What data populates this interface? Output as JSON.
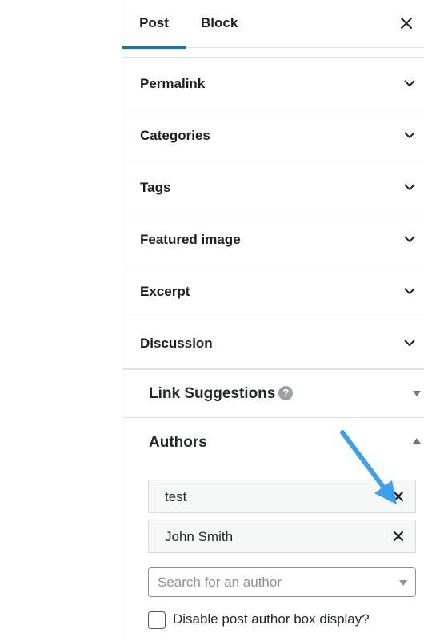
{
  "tabs": {
    "post": "Post",
    "block": "Block"
  },
  "panels": [
    {
      "label": "Permalink"
    },
    {
      "label": "Categories"
    },
    {
      "label": "Tags"
    },
    {
      "label": "Featured image"
    },
    {
      "label": "Excerpt"
    },
    {
      "label": "Discussion"
    }
  ],
  "link_suggestions": {
    "label": "Link Suggestions",
    "help_glyph": "?"
  },
  "authors": {
    "label": "Authors",
    "chips": [
      {
        "name": "test"
      },
      {
        "name": "John Smith"
      }
    ],
    "search_placeholder": "Search for an author",
    "disable_box_label": "Disable post author box display?",
    "disable_box_checked": false
  },
  "colors": {
    "accent": "#1a74b8",
    "annotation_arrow": "#3aa0f0"
  }
}
